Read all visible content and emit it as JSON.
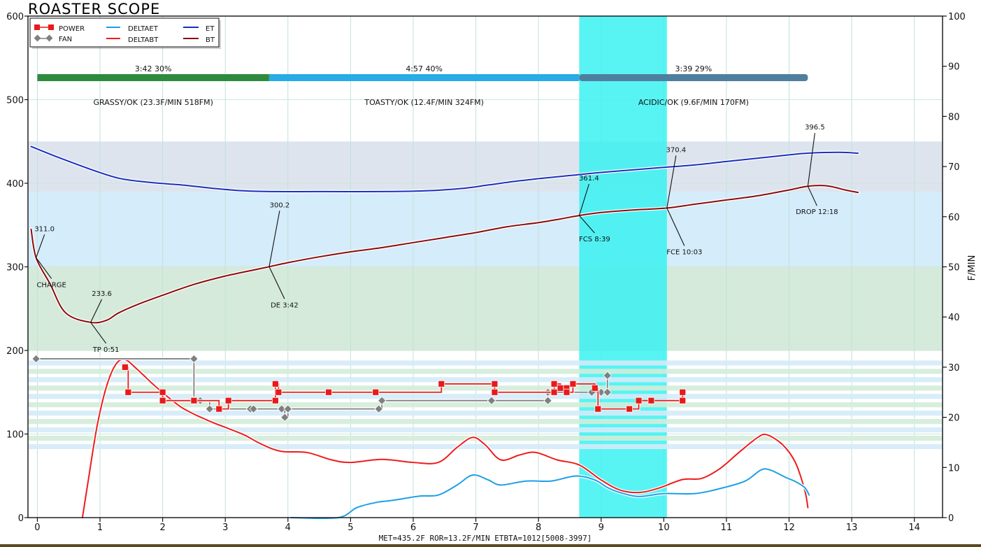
{
  "chart_data": {
    "type": "line",
    "title": "ROASTER SCOPE",
    "ylabel_right": "F/MIN",
    "xlim": [
      -0.15,
      14.45
    ],
    "ylim_left": [
      0,
      600
    ],
    "ylim_right": [
      0,
      100
    ],
    "x_ticks": [
      "0",
      "1",
      "2",
      "3",
      "4",
      "5",
      "6",
      "7",
      "8",
      "9",
      "10",
      "11",
      "12",
      "13",
      "14"
    ],
    "y_ticks_left": [
      "0",
      "100",
      "200",
      "300",
      "400",
      "500",
      "600"
    ],
    "y_ticks_right": [
      "0",
      "10",
      "20",
      "30",
      "40",
      "50",
      "60",
      "70",
      "80",
      "90",
      "100"
    ],
    "grid": true,
    "legend_position": "top-left",
    "legend": {
      "power": "POWER",
      "fan": "FAN",
      "deltaet": "DELTAET",
      "deltabt": "DELTABT",
      "et": "ET",
      "bt": "BT"
    },
    "colors": {
      "et": "#1a2fbf",
      "bt": "#8b0a0a",
      "deltaet": "#1ea0e6",
      "deltabt": "#ee1c1c",
      "power": "#e81a1a",
      "fan": "#808080",
      "first_crack": "#33f2f2",
      "phase_green": "#2e8b3e",
      "phase_blue": "#29abe6",
      "phase_slate": "#4f7f9f"
    },
    "bands": [
      {
        "from": 390,
        "to": 450,
        "color": "#dde4ee"
      },
      {
        "from": 300,
        "to": 390,
        "color": "#d5ecfa"
      },
      {
        "from": 200,
        "to": 300,
        "color": "#d5eadb"
      }
    ],
    "first_crack_window": [
      8.65,
      10.05
    ],
    "phases": [
      {
        "start": 0,
        "end": 3.7,
        "time": "3:42",
        "pct": "30%",
        "desc": "GRASSY/OK (23.3F/MIN  518FM)"
      },
      {
        "start": 3.7,
        "end": 8.65,
        "time": "4:57",
        "pct": "40%",
        "desc": "TOASTY/OK (12.4F/MIN  324FM)"
      },
      {
        "start": 8.65,
        "end": 12.3,
        "time": "3:39",
        "pct": "29%",
        "desc": "ACIDIC/OK (9.6F/MIN  170FM)"
      }
    ],
    "series": [
      {
        "name": "ET",
        "axis": "left",
        "points": [
          [
            -0.1,
            444
          ],
          [
            0.3,
            432
          ],
          [
            0.8,
            418
          ],
          [
            1.3,
            406
          ],
          [
            1.8,
            401
          ],
          [
            2.3,
            398
          ],
          [
            2.8,
            394
          ],
          [
            3.3,
            391
          ],
          [
            3.8,
            390
          ],
          [
            4.5,
            390
          ],
          [
            5.5,
            390
          ],
          [
            6.2,
            391
          ],
          [
            6.8,
            394
          ],
          [
            7.2,
            398
          ],
          [
            7.7,
            403
          ],
          [
            8.2,
            407
          ],
          [
            8.6,
            410
          ],
          [
            9.0,
            413
          ],
          [
            9.5,
            416
          ],
          [
            10.0,
            419
          ],
          [
            10.5,
            422
          ],
          [
            11.0,
            426
          ],
          [
            11.5,
            430
          ],
          [
            12.0,
            434
          ],
          [
            12.3,
            436
          ],
          [
            12.8,
            437
          ],
          [
            13.1,
            436
          ]
        ]
      },
      {
        "name": "BT",
        "axis": "left",
        "points": [
          [
            -0.1,
            345
          ],
          [
            -0.02,
            311
          ],
          [
            0.2,
            280
          ],
          [
            0.45,
            245
          ],
          [
            0.85,
            233.6
          ],
          [
            1.1,
            236
          ],
          [
            1.3,
            245
          ],
          [
            1.6,
            255
          ],
          [
            2.0,
            266
          ],
          [
            2.5,
            279
          ],
          [
            3.0,
            289
          ],
          [
            3.5,
            297
          ],
          [
            3.7,
            300.2
          ],
          [
            4.0,
            305
          ],
          [
            4.5,
            312
          ],
          [
            5.0,
            318
          ],
          [
            5.5,
            323
          ],
          [
            6.0,
            329
          ],
          [
            6.5,
            335
          ],
          [
            7.0,
            341
          ],
          [
            7.5,
            348
          ],
          [
            8.0,
            353
          ],
          [
            8.4,
            358
          ],
          [
            8.65,
            361.4
          ],
          [
            9.0,
            365
          ],
          [
            9.5,
            368
          ],
          [
            10.05,
            370.4
          ],
          [
            10.5,
            375
          ],
          [
            11.0,
            380
          ],
          [
            11.5,
            385
          ],
          [
            12.0,
            392
          ],
          [
            12.3,
            396.5
          ],
          [
            12.6,
            397
          ],
          [
            12.9,
            392
          ],
          [
            13.1,
            389
          ]
        ]
      },
      {
        "name": "DELTABT",
        "axis": "right",
        "points": [
          [
            0.72,
            0
          ],
          [
            0.82,
            8
          ],
          [
            0.95,
            18
          ],
          [
            1.1,
            26
          ],
          [
            1.25,
            30.5
          ],
          [
            1.4,
            31.5
          ],
          [
            1.6,
            29.5
          ],
          [
            1.9,
            26
          ],
          [
            2.3,
            22
          ],
          [
            2.7,
            19.5
          ],
          [
            3.0,
            18
          ],
          [
            3.3,
            16.5
          ],
          [
            3.6,
            14.5
          ],
          [
            3.9,
            13.2
          ],
          [
            4.3,
            13
          ],
          [
            4.7,
            11.5
          ],
          [
            5.0,
            11
          ],
          [
            5.5,
            11.6
          ],
          [
            6.0,
            11
          ],
          [
            6.4,
            11
          ],
          [
            6.7,
            14
          ],
          [
            6.95,
            16
          ],
          [
            7.15,
            14.5
          ],
          [
            7.4,
            11.5
          ],
          [
            7.7,
            12.5
          ],
          [
            7.95,
            13
          ],
          [
            8.3,
            11.5
          ],
          [
            8.65,
            10.5
          ],
          [
            9.0,
            7.5
          ],
          [
            9.3,
            5.5
          ],
          [
            9.6,
            5
          ],
          [
            9.9,
            5.8
          ],
          [
            10.3,
            7.6
          ],
          [
            10.6,
            7.8
          ],
          [
            10.9,
            9.8
          ],
          [
            11.2,
            13
          ],
          [
            11.5,
            16
          ],
          [
            11.65,
            16.5
          ],
          [
            11.9,
            14.5
          ],
          [
            12.1,
            11
          ],
          [
            12.25,
            5.5
          ],
          [
            12.3,
            2
          ]
        ]
      },
      {
        "name": "DELTAET",
        "axis": "right",
        "points": [
          [
            4.05,
            0
          ],
          [
            4.8,
            0
          ],
          [
            5.1,
            2
          ],
          [
            5.4,
            3
          ],
          [
            5.7,
            3.5
          ],
          [
            6.1,
            4.3
          ],
          [
            6.4,
            4.5
          ],
          [
            6.7,
            6.5
          ],
          [
            6.95,
            8.5
          ],
          [
            7.2,
            7.5
          ],
          [
            7.4,
            6.5
          ],
          [
            7.8,
            7.3
          ],
          [
            8.2,
            7.3
          ],
          [
            8.6,
            8.3
          ],
          [
            8.9,
            7.5
          ],
          [
            9.1,
            6
          ],
          [
            9.3,
            5
          ],
          [
            9.6,
            4.2
          ],
          [
            10.0,
            4.8
          ],
          [
            10.5,
            4.8
          ],
          [
            10.9,
            5.8
          ],
          [
            11.3,
            7.3
          ],
          [
            11.55,
            9.5
          ],
          [
            11.7,
            9.5
          ],
          [
            11.95,
            8
          ],
          [
            12.1,
            7.2
          ],
          [
            12.25,
            6
          ],
          [
            12.32,
            4.5
          ]
        ]
      }
    ],
    "power": {
      "name": "POWER",
      "axis": "left",
      "points": [
        [
          1.4,
          180
        ],
        [
          1.45,
          150
        ],
        [
          2.0,
          150
        ],
        [
          2.0,
          140
        ],
        [
          2.5,
          140
        ],
        [
          2.9,
          130
        ],
        [
          3.05,
          140
        ],
        [
          3.8,
          140
        ],
        [
          3.8,
          160
        ],
        [
          3.85,
          150
        ],
        [
          4.65,
          150
        ],
        [
          5.4,
          150
        ],
        [
          6.45,
          160
        ],
        [
          7.3,
          160
        ],
        [
          7.3,
          150
        ],
        [
          8.25,
          150
        ],
        [
          8.25,
          160
        ],
        [
          8.35,
          155
        ],
        [
          8.45,
          155
        ],
        [
          8.45,
          150
        ],
        [
          8.55,
          160
        ],
        [
          8.9,
          155
        ],
        [
          8.95,
          130
        ],
        [
          9.45,
          130
        ],
        [
          9.6,
          140
        ],
        [
          9.8,
          140
        ],
        [
          10.3,
          140
        ],
        [
          10.3,
          150
        ]
      ]
    },
    "fan": {
      "name": "FAN",
      "axis": "left",
      "points": [
        [
          -0.02,
          190
        ],
        [
          2.5,
          190
        ],
        [
          2.5,
          140
        ],
        [
          2.6,
          140
        ],
        [
          2.75,
          130
        ],
        [
          3.4,
          130
        ],
        [
          3.45,
          130
        ],
        [
          3.9,
          130
        ],
        [
          3.95,
          120
        ],
        [
          4.0,
          130
        ],
        [
          5.45,
          130
        ],
        [
          5.5,
          140
        ],
        [
          7.25,
          140
        ],
        [
          8.15,
          140
        ],
        [
          8.15,
          150
        ],
        [
          8.85,
          150
        ],
        [
          9.0,
          150
        ],
        [
          9.1,
          170
        ],
        [
          9.1,
          150
        ]
      ]
    },
    "annotations": [
      {
        "label": "311.0",
        "pos": "above",
        "x": -0.02,
        "y": 311
      },
      {
        "label": "CHARGE",
        "pos": "below",
        "x": -0.02,
        "y": 311
      },
      {
        "label": "233.6",
        "pos": "above",
        "x": 0.85,
        "y": 233.6
      },
      {
        "label": "TP 0:51",
        "pos": "below",
        "x": 0.85,
        "y": 233.6
      },
      {
        "label": "300.2",
        "pos": "above",
        "x": 3.7,
        "y": 300.2
      },
      {
        "label": "DE 3:42",
        "pos": "below",
        "x": 3.7,
        "y": 300.2
      },
      {
        "label": "361.4",
        "pos": "above",
        "x": 8.65,
        "y": 361.4
      },
      {
        "label": "FCS 8:39",
        "pos": "below",
        "x": 8.65,
        "y": 361.4
      },
      {
        "label": "370.4",
        "pos": "above",
        "x": 10.05,
        "y": 370.4
      },
      {
        "label": "FCE 10:03",
        "pos": "below",
        "x": 10.05,
        "y": 370.4
      },
      {
        "label": "396.5",
        "pos": "above",
        "x": 12.3,
        "y": 396.5
      },
      {
        "label": "DROP 12:18",
        "pos": "below",
        "x": 12.3,
        "y": 396.5
      }
    ],
    "footer": "MET=435.2F    ROR=13.2F/MIN    ETBTA=1012[5008-3997]"
  }
}
